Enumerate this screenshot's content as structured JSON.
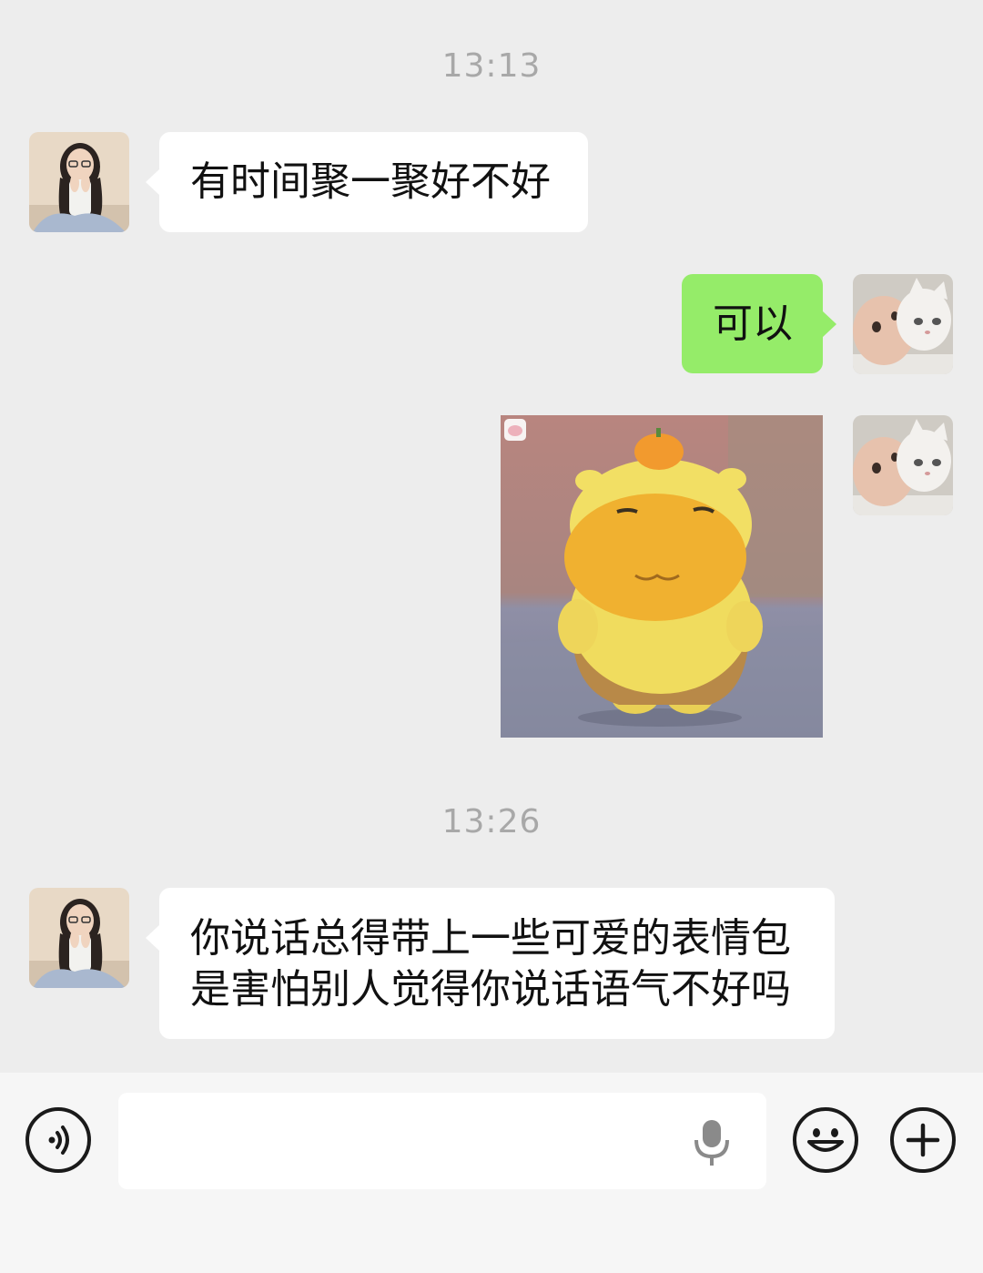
{
  "messages": {
    "time_1": "13:13",
    "msg_1": "有时间聚一聚好不好",
    "msg_2": "可以",
    "time_2": "13:26",
    "msg_4_line1": "你说话总得带上一些可爱的表情包",
    "msg_4_line2": "是害怕别人觉得你说话语气不好吗"
  },
  "icons": {
    "voice": "voice-icon",
    "mic": "mic-icon",
    "emoji": "emoji-icon",
    "plus": "plus-icon"
  },
  "colors": {
    "background": "#ededed",
    "incoming_bubble": "#ffffff",
    "outgoing_bubble": "#95ec69",
    "timestamp": "#a8a8a8"
  }
}
